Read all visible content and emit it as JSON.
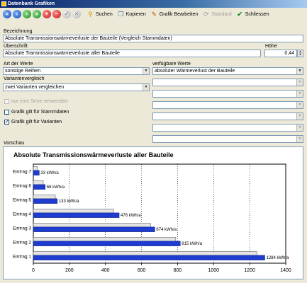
{
  "window": {
    "title": "Datenbank Grafiken"
  },
  "toolbar": {
    "search_label": "Suchen",
    "copy_label": "Kopieren",
    "edit_chart_label": "Grafik Bearbeiten",
    "standard_label": "Standard",
    "close_label": "Schliessen"
  },
  "form": {
    "bezeichnung_label": "Bezeichnung",
    "bezeichnung_value": "Absolute Transmissionswärmeverluste der Bauteile (Vergleich Stammdaten)",
    "ueberschrift_label": "Überschrift",
    "ueberschrift_value": "Absolute Transmissionswärmeverluste aller Bauteile",
    "hoehe_label": "Höhe",
    "hoehe_value": "0,44",
    "art_label": "Art der Werte",
    "art_value": "sonstige Reihen",
    "verfuegbar_label": "verfügbare Werte",
    "verfuegbar_value": "absoluter Wärmeverlust der Bauteile",
    "variantenvergleich_label": "Variantenvergleich",
    "variantenvergleich_value": "zwei Varianten vergleichen",
    "nur_eine_serie_label": "nur eine Serie verwenden",
    "grafik_stammdaten_label": "Grafik gilt für Stammdaten",
    "grafik_varianten_label": "Grafik gilt für Varianten",
    "vorschau_label": "Vorschau"
  },
  "chart_data": {
    "type": "bar",
    "orientation": "horizontal",
    "title": "Absolute Transmissionswärmeverluste aller Bauteile",
    "categories": [
      "Eintrag 7",
      "Eintrag 6",
      "Eintrag 5",
      "Eintrag 4",
      "Eintrag 3",
      "Eintrag 2",
      "Eintrag 1"
    ],
    "series": [
      {
        "values": [
          33,
          66,
          133,
          476,
          674,
          815,
          1284
        ],
        "color": "#1e3cd0"
      },
      {
        "values": [
          22,
          55,
          122,
          445,
          650,
          790,
          1240
        ],
        "color": "#e4e4e4"
      }
    ],
    "data_labels": [
      "33 kWh/a",
      "66 kWh/a",
      "133 kWh/a",
      "476 kWh/a",
      "674 kWh/a",
      "815 kWh/a",
      "1284 kWh/a"
    ],
    "xlim": [
      0,
      1400
    ],
    "x_ticks": [
      "0",
      "200",
      "400",
      "600",
      "800",
      "1000",
      "1200",
      "1400"
    ],
    "grid": true
  }
}
